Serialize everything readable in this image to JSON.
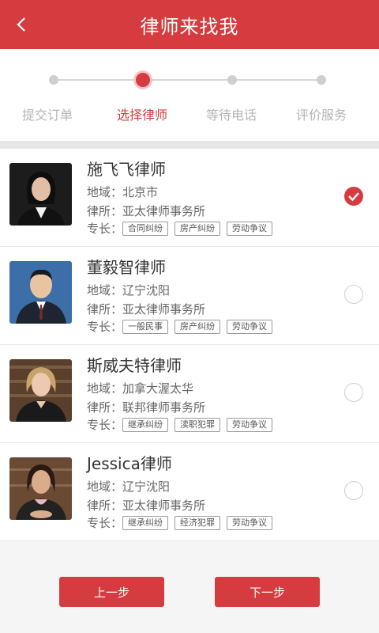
{
  "header": {
    "title": "律师来找我",
    "back_icon": "chevron-left-icon"
  },
  "steps": [
    {
      "label": "提交订单",
      "active": false
    },
    {
      "label": "选择律师",
      "active": true
    },
    {
      "label": "等待电话",
      "active": false
    },
    {
      "label": "评价服务",
      "active": false
    }
  ],
  "labels": {
    "region": "地域：",
    "firm": "律所：",
    "specialty": "专长："
  },
  "lawyers": [
    {
      "name": "施飞飞律师",
      "region": "北京市",
      "firm": "亚太律师事务所",
      "specialties": [
        "合同纠纷",
        "房产纠纷",
        "劳动争议"
      ],
      "selected": true
    },
    {
      "name": "董毅智律师",
      "region": "辽宁沈阳",
      "firm": "亚太律师事务所",
      "specialties": [
        "一般民事",
        "房产纠纷",
        "劳动争议"
      ],
      "selected": false
    },
    {
      "name": "斯威夫特律师",
      "region": "加拿大渥太华",
      "firm": "联邦律师事务所",
      "specialties": [
        "继承纠纷",
        "渎职犯罪",
        "劳动争议"
      ],
      "selected": false
    },
    {
      "name": "Jessica律师",
      "region": "辽宁沈阳",
      "firm": "亚太律师事务所",
      "specialties": [
        "继承纠纷",
        "经济犯罪",
        "劳动争议"
      ],
      "selected": false
    }
  ],
  "buttons": {
    "prev": "上一步",
    "next": "下一步"
  },
  "colors": {
    "accent": "#d63c3f",
    "inactive": "#cfcfcf"
  }
}
